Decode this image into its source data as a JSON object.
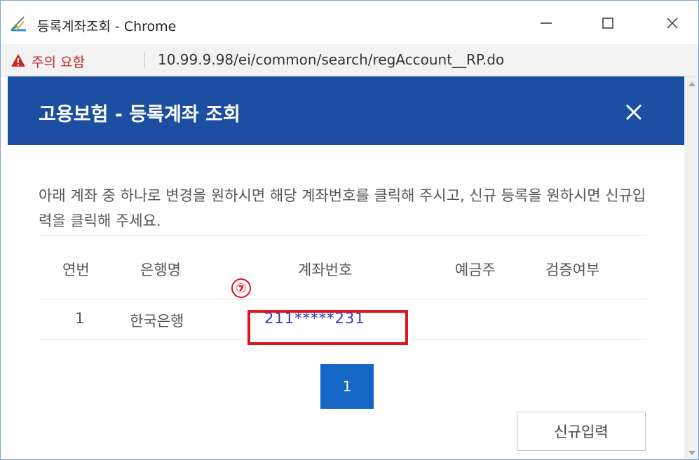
{
  "window": {
    "title": "등록계좌조회 - Chrome",
    "icon": "chrome-app-icon",
    "controls": [
      "minimize-icon",
      "maximize-icon",
      "close-icon"
    ]
  },
  "address_bar": {
    "warning_label": "주의 요함",
    "url": "10.99.9.98/ei/common/search/regAccount__RP.do",
    "warning_icon": "warning-triangle-icon"
  },
  "modal": {
    "title": "고용보험 - 등록계좌 조회",
    "close_icon": "close-icon",
    "description": "아래 계좌 중 하나로 변경을 원하시면 해당 계좌번호를 클릭해 주시고, 신규 등록을 원하시면 신규입력을 클릭해 주세요.",
    "table": {
      "headers": [
        "연번",
        "은행명",
        "계좌번호",
        "예금주",
        "검증여부"
      ],
      "rows": [
        {
          "no": "1",
          "bank": "한국은행",
          "account": "211*****231",
          "holder": "",
          "verified": ""
        }
      ]
    },
    "step_marker": "⑦",
    "pagination": {
      "current_page": "1"
    },
    "new_button_label": "신규입력"
  },
  "colors": {
    "header_bg": "#1c4fa1",
    "page_button_bg": "#1466c7",
    "account_link": "#2b3cc4",
    "highlight": "#e0141b",
    "warning": "#c62828"
  }
}
